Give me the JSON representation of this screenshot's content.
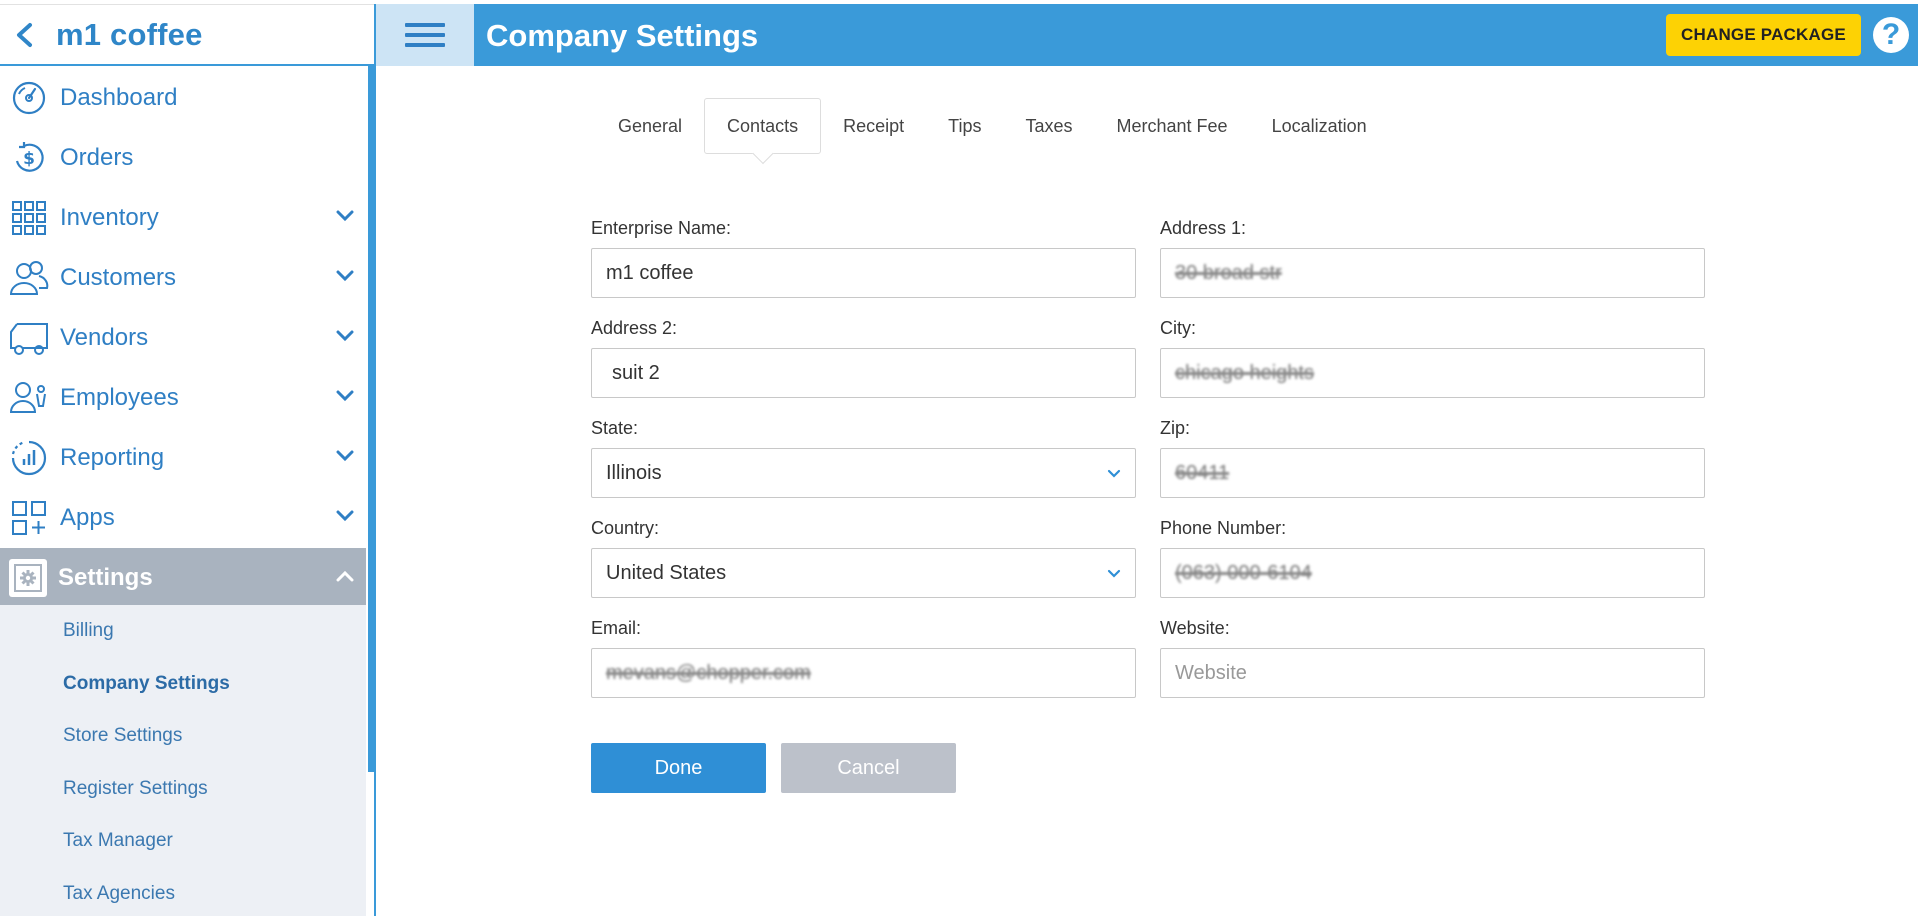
{
  "app": {
    "name": "m1 coffee"
  },
  "header": {
    "title": "Company Settings",
    "package_button": "CHANGE PACKAGE",
    "help_label": "?"
  },
  "sidebar": {
    "items": [
      {
        "label": "Dashboard",
        "icon": "dashboard-icon",
        "expandable": false
      },
      {
        "label": "Orders",
        "icon": "dollar-refresh-icon",
        "expandable": false
      },
      {
        "label": "Inventory",
        "icon": "grid-icon",
        "expandable": true
      },
      {
        "label": "Customers",
        "icon": "users-icon",
        "expandable": true
      },
      {
        "label": "Vendors",
        "icon": "truck-icon",
        "expandable": true
      },
      {
        "label": "Employees",
        "icon": "employee-icon",
        "expandable": true
      },
      {
        "label": "Reporting",
        "icon": "chart-icon",
        "expandable": true
      },
      {
        "label": "Apps",
        "icon": "apps-icon",
        "expandable": true
      },
      {
        "label": "Settings",
        "icon": "gear-icon",
        "expandable": true,
        "active": true
      }
    ],
    "subitems": [
      {
        "label": "Billing"
      },
      {
        "label": "Company Settings",
        "active": true
      },
      {
        "label": "Store Settings"
      },
      {
        "label": "Register Settings"
      },
      {
        "label": "Tax Manager"
      },
      {
        "label": "Tax Agencies"
      }
    ]
  },
  "tabs": [
    {
      "label": "General"
    },
    {
      "label": "Contacts",
      "active": true
    },
    {
      "label": "Receipt"
    },
    {
      "label": "Tips"
    },
    {
      "label": "Taxes"
    },
    {
      "label": "Merchant Fee"
    },
    {
      "label": "Localization"
    }
  ],
  "form": {
    "enterprise_name": {
      "label": "Enterprise Name:",
      "value": "m1 coffee"
    },
    "address1": {
      "label": "Address 1:",
      "value": "30 broad str"
    },
    "address2": {
      "label": "Address 2:",
      "value": "suit 2"
    },
    "city": {
      "label": "City:",
      "value": "chicago heights"
    },
    "state": {
      "label": "State:",
      "value": "Illinois"
    },
    "zip": {
      "label": "Zip:",
      "value": "60411"
    },
    "country": {
      "label": "Country:",
      "value": "United States"
    },
    "phone": {
      "label": "Phone Number:",
      "value": "(063) 000-6104"
    },
    "email": {
      "label": "Email:",
      "value": "mevans@chopper.com"
    },
    "website": {
      "label": "Website:",
      "value": "",
      "placeholder": "Website"
    }
  },
  "buttons": {
    "done": "Done",
    "cancel": "Cancel"
  },
  "colors": {
    "primary": "#3a9ad9",
    "accent_yellow": "#fdd204",
    "sidebar_active": "#a9b3bf",
    "cancel_gray": "#bcc1ca"
  }
}
